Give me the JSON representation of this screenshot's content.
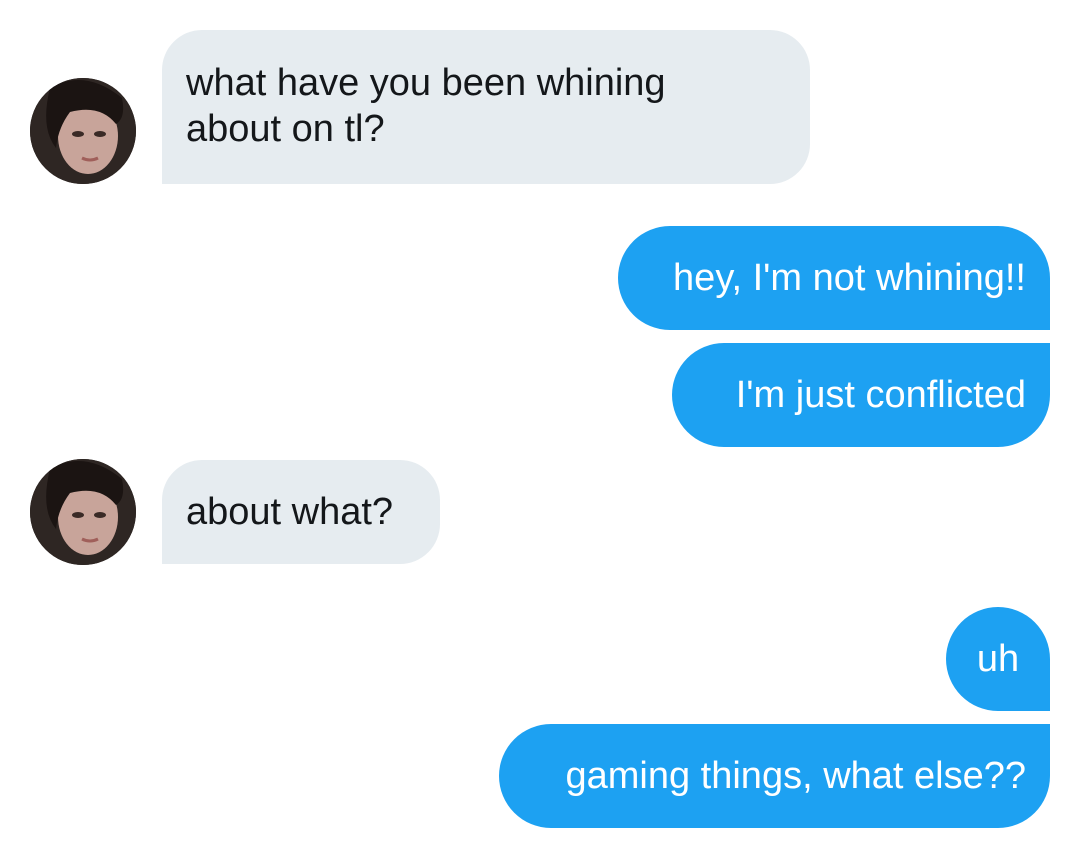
{
  "conversation": {
    "messages": [
      {
        "sender": "them",
        "text": "what have you been whining\nabout on tl?"
      },
      {
        "sender": "me",
        "text": "hey, I'm not whining!!"
      },
      {
        "sender": "me",
        "text": "I'm just conflicted"
      },
      {
        "sender": "them",
        "text": "about what?"
      },
      {
        "sender": "me",
        "text": "uh"
      },
      {
        "sender": "me",
        "text": "gaming things, what else??"
      }
    ]
  },
  "colors": {
    "incoming_bubble": "#e6ecf0",
    "outgoing_bubble": "#1da1f2",
    "incoming_text": "#14171a",
    "outgoing_text": "#ffffff"
  },
  "icons": {
    "avatar": "contact-avatar-photo"
  }
}
